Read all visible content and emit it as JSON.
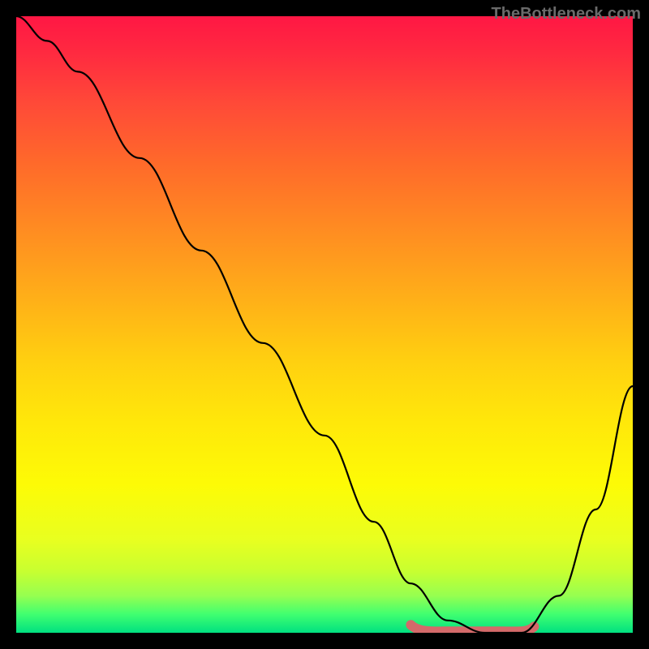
{
  "watermark": "TheBottleneck.com",
  "chart_data": {
    "type": "line",
    "title": "",
    "xlabel": "",
    "ylabel": "",
    "xlim": [
      0,
      100
    ],
    "ylim": [
      0,
      100
    ],
    "background_gradient": [
      "#ff1744",
      "#ffeb3b",
      "#00e676"
    ],
    "series": [
      {
        "name": "bottleneck-curve",
        "x": [
          0,
          5,
          10,
          20,
          30,
          40,
          50,
          58,
          64,
          70,
          76,
          82,
          88,
          94,
          100
        ],
        "values": [
          100,
          96,
          91,
          77,
          62,
          47,
          32,
          18,
          8,
          2,
          0,
          0,
          6,
          20,
          40
        ]
      }
    ],
    "highlight": {
      "name": "optimal-range",
      "x_range": [
        64,
        84
      ],
      "y": 0.5
    }
  }
}
